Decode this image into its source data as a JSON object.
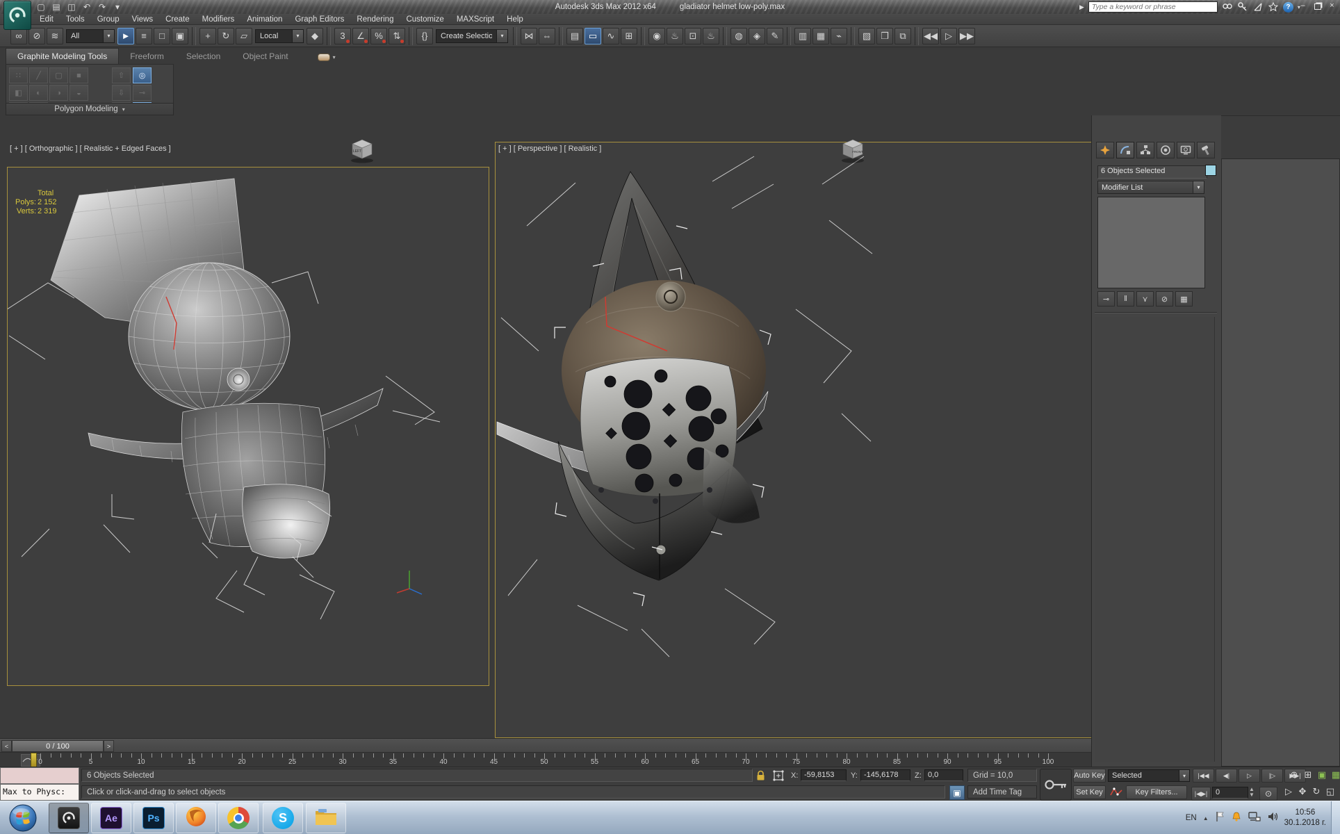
{
  "title_bar": {
    "app_title": "Autodesk 3ds Max  2012 x64",
    "doc_title": "gladiator helmet low-poly.max",
    "search_placeholder": "Type a keyword or phrase",
    "qat": [
      {
        "n": "new-file-icon",
        "g": "▢"
      },
      {
        "n": "open-file-icon",
        "g": "▤"
      },
      {
        "n": "save-file-icon",
        "g": "◫"
      },
      {
        "n": "undo-icon",
        "g": "↶"
      },
      {
        "n": "redo-icon",
        "g": "↷"
      },
      {
        "n": "project-dropdown-icon",
        "g": "▾"
      }
    ],
    "help_glyph": "?",
    "minimize_glyph": "–",
    "close_glyph": "×"
  },
  "menu_bar": {
    "items": [
      "Edit",
      "Tools",
      "Group",
      "Views",
      "Create",
      "Modifiers",
      "Animation",
      "Graph Editors",
      "Rendering",
      "Customize",
      "MAXScript",
      "Help"
    ]
  },
  "toolbar": {
    "items": [
      {
        "n": "select-and-link-icon",
        "g": "∞"
      },
      {
        "n": "unlink-selection-icon",
        "g": "⊘"
      },
      {
        "n": "bind-to-space-warp-icon",
        "g": "≋"
      },
      {
        "n": "selection-filter-dropdown",
        "dd": "All"
      },
      {
        "n": "select-object-icon",
        "g": "►",
        "active": true
      },
      {
        "n": "select-by-name-icon",
        "g": "≡"
      },
      {
        "n": "rectangular-selection-region-icon",
        "g": "□"
      },
      {
        "n": "window-crossing-icon",
        "g": "▣"
      },
      {
        "sep": true
      },
      {
        "n": "select-and-move-icon",
        "g": "+"
      },
      {
        "n": "select-and-rotate-icon",
        "g": "↻"
      },
      {
        "n": "select-and-scale-icon",
        "g": "▱"
      },
      {
        "n": "reference-coordinate-system-dropdown",
        "dd": "Local"
      },
      {
        "n": "select-and-manipulate-icon",
        "g": "◆"
      },
      {
        "sep": true
      },
      {
        "n": "snaps-toggle-icon",
        "g": "3",
        "snap": true
      },
      {
        "n": "angle-snap-icon",
        "g": "∠",
        "snap": true
      },
      {
        "n": "percent-snap-icon",
        "g": "%",
        "snap": true
      },
      {
        "n": "spinner-snap-icon",
        "g": "⇅",
        "snap": true
      },
      {
        "sep": true
      },
      {
        "n": "edit-named-selection-sets-icon",
        "g": "{}"
      },
      {
        "n": "named-selection-sets-dropdown",
        "dd": "Create Selection Se",
        "wide": true
      },
      {
        "sep": true
      },
      {
        "n": "mirror-icon",
        "g": "⋈"
      },
      {
        "n": "align-icon",
        "g": "⇔"
      },
      {
        "sep": true
      },
      {
        "n": "manage-layers-icon",
        "g": "▤"
      },
      {
        "n": "graphite-ribbon-toggle-icon",
        "g": "▭",
        "active": true
      },
      {
        "n": "curve-editor-icon",
        "g": "∿"
      },
      {
        "n": "schematic-view-icon",
        "g": "⊞"
      },
      {
        "sep": true
      },
      {
        "n": "material-editor-icon",
        "g": "◉"
      },
      {
        "n": "render-setup-icon",
        "g": "♨"
      },
      {
        "n": "rendered-frame-window-icon",
        "g": "⊡"
      },
      {
        "n": "render-production-icon",
        "g": "♨"
      },
      {
        "sep": true
      },
      {
        "n": "render-in-cloud-icon",
        "g": "◍"
      },
      {
        "n": "material-explorer-icon",
        "g": "◈"
      },
      {
        "n": "scene-tools-icon",
        "g": "✎"
      },
      {
        "sep": true
      },
      {
        "n": "layer-explorer-icon",
        "g": "▥"
      },
      {
        "n": "object-paint-tools-icon",
        "g": "▦"
      },
      {
        "n": "link-tools-icon",
        "g": "⌁"
      },
      {
        "sep": true
      },
      {
        "n": "manage-scene-states-icon",
        "g": "▧"
      },
      {
        "n": "container-tools-icon",
        "g": "❒"
      },
      {
        "n": "proxy-tools-icon",
        "g": "⧉"
      },
      {
        "sep": true
      },
      {
        "n": "step-back-icon",
        "g": "◀◀"
      },
      {
        "n": "step-play-icon",
        "g": "▷"
      },
      {
        "n": "step-forward-icon",
        "g": "▶▶"
      }
    ]
  },
  "ribbon": {
    "tabs": [
      {
        "label": "Graphite Modeling Tools",
        "active": true
      },
      {
        "label": "Freeform",
        "active": false
      },
      {
        "label": "Selection",
        "active": false
      },
      {
        "label": "Object Paint",
        "active": false
      }
    ],
    "panel_label": "Polygon Modeling",
    "panel_caret": "▾",
    "row1": [
      {
        "n": "vertex-mode-icon",
        "g": "∷"
      },
      {
        "n": "edge-mode-icon",
        "g": "╱"
      },
      {
        "n": "border-mode-icon",
        "g": "▢"
      },
      {
        "n": "polygon-mode-icon",
        "g": "■"
      },
      {
        "n": "element-mode-icon",
        "g": "◧"
      }
    ],
    "row2": [
      {
        "n": "pivot-tool-icon",
        "g": "◐"
      },
      {
        "n": "preserve-uvs-icon",
        "g": "◑"
      },
      {
        "n": "tweak-icon",
        "g": "◒"
      },
      {
        "n": "edit-poly-mode-icon",
        "g": "⊞"
      },
      {
        "n": "collapse-icon",
        "g": "●"
      }
    ],
    "sideA": [
      {
        "n": "next-modifier-icon",
        "g": "⇧"
      },
      {
        "n": "previous-modifier-icon",
        "g": "⇩"
      },
      {
        "n": "modifier-stack-icon",
        "g": "≔"
      }
    ],
    "sideB": [
      {
        "n": "show-end-result-toggle-icon",
        "g": "◎",
        "on": true
      },
      {
        "n": "pin-icon",
        "g": "⊸",
        "on": false
      },
      {
        "n": "ignore-backfacing-icon",
        "g": "⇕",
        "on": true
      }
    ]
  },
  "viewports": {
    "left": {
      "label": "[ + ] [ Orthographic ] [ Realistic + Edged Faces ]",
      "stats": {
        "header": "Total",
        "polys_label": "Polys:",
        "polys": "2 152",
        "verts_label": "Verts:",
        "verts": "2 319"
      },
      "viewcube": "LEFT"
    },
    "right": {
      "label": "[ + ] [ Perspective ] [ Realistic ]",
      "viewcube": "FRONT"
    }
  },
  "command_panel": {
    "selection_name": "6 Objects Selected",
    "modifier_list": "Modifier List",
    "dropdown_arrow": "▾",
    "stack_buttons": [
      {
        "n": "pin-stack-icon",
        "g": "⊸"
      },
      {
        "n": "show-end-result-icon",
        "g": "‖"
      },
      {
        "n": "make-unique-icon",
        "g": "⋎"
      },
      {
        "n": "remove-modifier-icon",
        "g": "⊘"
      },
      {
        "n": "configure-modifier-sets-icon",
        "g": "▦"
      }
    ]
  },
  "timeline": {
    "slider_value": "0 / 100",
    "prev_arrow": "<",
    "next_arrow": ">",
    "tick_labels": [
      "0",
      "5",
      "10",
      "15",
      "20",
      "25",
      "30",
      "35",
      "40",
      "45",
      "50",
      "55",
      "60",
      "65",
      "70",
      "75",
      "80",
      "85",
      "90",
      "95",
      "100"
    ]
  },
  "status_bar": {
    "listener_text": "Max to Physc:",
    "selection_status": "6 Objects Selected",
    "prompt": "Click or click-and-drag to select objects",
    "coords": {
      "x_label": "X:",
      "x": "-59,8153",
      "y_label": "Y:",
      "y": "-145,6178",
      "z_label": "Z:",
      "z": "0,0"
    },
    "grid": "Grid = 10,0",
    "add_time_tag": "Add Time Tag",
    "auto_key": "Auto Key",
    "set_key": "Set Key",
    "key_mode": "Selected",
    "key_filters": "Key Filters...",
    "frame_field": "0",
    "playback": [
      {
        "n": "go-to-start-button",
        "g": "|◀◀"
      },
      {
        "n": "previous-frame-button",
        "g": "◀|"
      },
      {
        "n": "play-button",
        "g": "▷"
      },
      {
        "n": "next-frame-button",
        "g": "|▷"
      },
      {
        "n": "go-to-end-button",
        "g": "▶▶|"
      }
    ],
    "key_step_glyph": "|◀▶|",
    "time_config_glyph": "⊙",
    "isolate_glyph": "▣",
    "nav1": [
      {
        "n": "zoom-button",
        "g": "⊕"
      },
      {
        "n": "zoom-all-button",
        "g": "⊞"
      },
      {
        "n": "zoom-extents-button",
        "g": "▣",
        "green": true
      },
      {
        "n": "zoom-extents-all-button",
        "g": "▦",
        "green": true
      }
    ],
    "nav2": [
      {
        "n": "selection-region-button",
        "g": "▷"
      },
      {
        "n": "pan-button",
        "g": "✥"
      },
      {
        "n": "orbit-button",
        "g": "↻"
      },
      {
        "n": "maximize-viewport-button",
        "g": "◱"
      }
    ]
  },
  "taskbar": {
    "skype_glyph": "S",
    "ae_glyph": "Ae",
    "ps_glyph": "Ps",
    "tray": {
      "language": "EN",
      "chevron": "▲",
      "time": "10:56",
      "date": "30.1.2018 г."
    }
  },
  "colors": {
    "viewport_border": "#a8913d",
    "stats_text": "#d9c83c",
    "swatch_blue": "#9cd4e4",
    "snap_dot": "#c83c2c",
    "extents_green": "#8cc152",
    "active_blue": "#3a5f8a"
  }
}
